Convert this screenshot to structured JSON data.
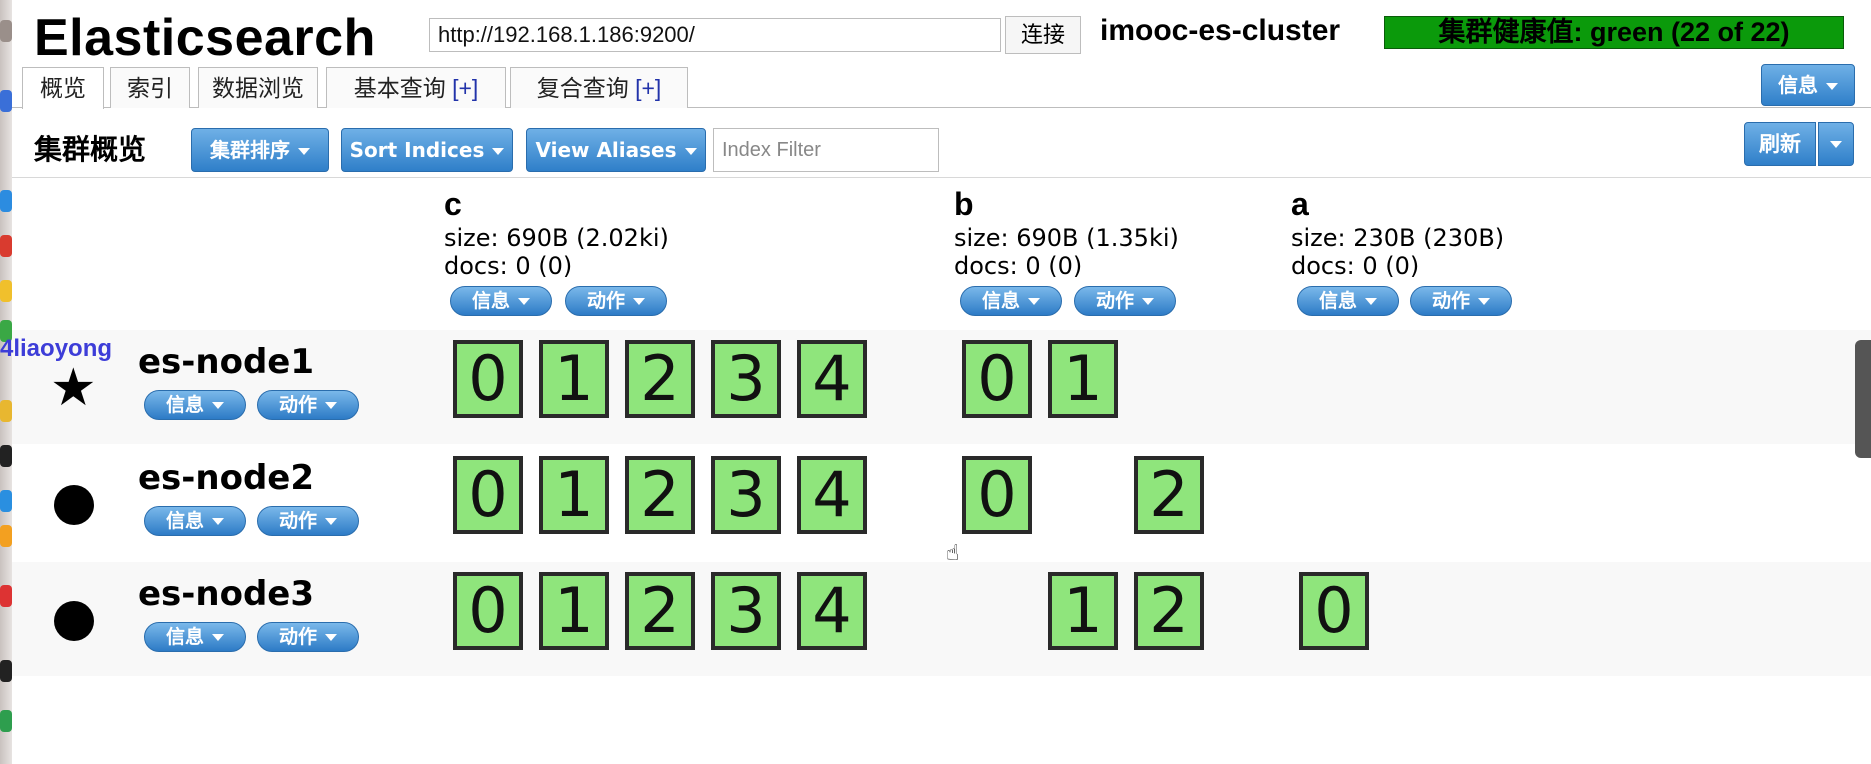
{
  "header": {
    "app_title": "Elasticsearch",
    "url_value": "http://192.168.1.186:9200/",
    "connect_label": "连接",
    "cluster_name": "imooc-es-cluster",
    "health_text": "集群健康值: green (22 of 22)",
    "info_menu_label": "信息"
  },
  "tabs": [
    {
      "label": "概览",
      "active": true
    },
    {
      "label": "索引"
    },
    {
      "label": "数据浏览"
    },
    {
      "label": "基本查询",
      "extra": "[+]"
    },
    {
      "label": "复合查询",
      "extra": "[+]"
    }
  ],
  "toolbar": {
    "title": "集群概览",
    "sort_cluster_label": "集群排序",
    "sort_indices_label": "Sort Indices",
    "view_aliases_label": "View Aliases",
    "index_filter_placeholder": "Index Filter",
    "refresh_label": "刷新"
  },
  "buttons": {
    "info": "信息",
    "action": "动作"
  },
  "indices": [
    {
      "name": "c",
      "size": "size: 690B (2.02ki)",
      "docs": "docs: 0 (0)"
    },
    {
      "name": "b",
      "size": "size: 690B (1.35ki)",
      "docs": "docs: 0 (0)"
    },
    {
      "name": "a",
      "size": "size: 230B (230B)",
      "docs": "docs: 0 (0)"
    }
  ],
  "nodes": [
    {
      "name": "es-node1",
      "marker": "star",
      "marker_glyph": "★",
      "shards": {
        "c": [
          "0",
          "1",
          "2",
          "3",
          "4"
        ],
        "b": [
          "0",
          "1"
        ],
        "a": []
      }
    },
    {
      "name": "es-node2",
      "marker": "dot",
      "shards": {
        "c": [
          "0",
          "1",
          "2",
          "3",
          "4"
        ],
        "b": [
          "0",
          "2"
        ],
        "a": []
      }
    },
    {
      "name": "es-node3",
      "marker": "dot",
      "shards": {
        "c": [
          "0",
          "1",
          "2",
          "3",
          "4"
        ],
        "b": [
          "1",
          "2"
        ],
        "a": [
          "0"
        ]
      }
    }
  ],
  "overlay": {
    "username": "4liaoyong"
  },
  "colors": {
    "health_green": "#0b9a0b",
    "shard_fill": "#8fe57c",
    "button_blue": "#2f7fc9"
  }
}
